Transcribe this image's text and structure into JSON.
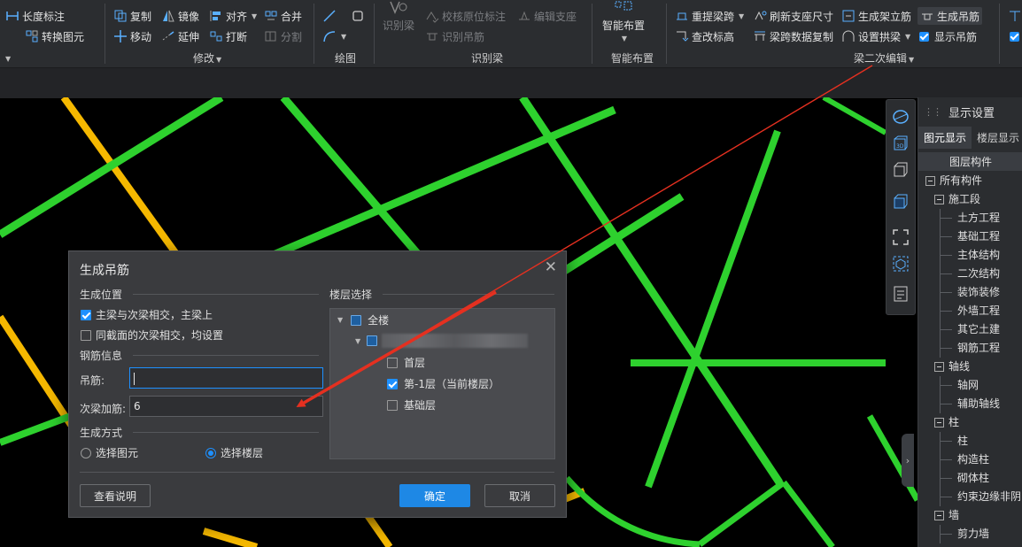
{
  "ribbon": {
    "tools": {
      "length_dim": "长度标注",
      "convert": "转换图元",
      "copy": "复制",
      "mirror": "镜像",
      "align": "对齐",
      "merge": "合并",
      "move": "移动",
      "extend": "延伸",
      "break": "打断",
      "split": "分割",
      "identify_beam": "识别梁",
      "verify_span": "校核原位标注",
      "edit_support": "编辑支座",
      "identify_hanger": "识别吊筋",
      "smart_layout": "智能布置",
      "redo_span": "重提梁跨",
      "refresh_support": "刷新支座尺寸",
      "gen_stirrup": "生成架立筋",
      "gen_hanger": "生成吊筋",
      "check_elev": "查改标高",
      "span_copy": "梁跨数据复制",
      "set_arch": "设置拱梁",
      "show_hanger": "显示吊筋"
    },
    "groups": {
      "modify": "修改",
      "draw": "绘图",
      "identify": "识别梁",
      "smart": "智能布置",
      "secondary_edit": "梁二次编辑"
    }
  },
  "panel": {
    "title": "显示设置",
    "tabs": [
      "图元显示",
      "楼层显示"
    ],
    "column_header": "图层构件",
    "tree": [
      {
        "label": "所有构件",
        "level": 0,
        "box": true
      },
      {
        "label": "施工段",
        "level": 1,
        "box": true
      },
      {
        "label": "土方工程",
        "level": 2,
        "box": false
      },
      {
        "label": "基础工程",
        "level": 2,
        "box": false
      },
      {
        "label": "主体结构",
        "level": 2,
        "box": false
      },
      {
        "label": "二次结构",
        "level": 2,
        "box": false
      },
      {
        "label": "装饰装修",
        "level": 2,
        "box": false
      },
      {
        "label": "外墙工程",
        "level": 2,
        "box": false
      },
      {
        "label": "其它土建",
        "level": 2,
        "box": false
      },
      {
        "label": "钢筋工程",
        "level": 2,
        "box": false
      },
      {
        "label": "轴线",
        "level": 1,
        "box": true
      },
      {
        "label": "轴网",
        "level": 2,
        "box": false
      },
      {
        "label": "辅助轴线",
        "level": 2,
        "box": false
      },
      {
        "label": "柱",
        "level": 1,
        "box": true
      },
      {
        "label": "柱",
        "level": 2,
        "box": false
      },
      {
        "label": "构造柱",
        "level": 2,
        "box": false
      },
      {
        "label": "砌体柱",
        "level": 2,
        "box": false
      },
      {
        "label": "约束边缘非阴",
        "level": 2,
        "box": false
      },
      {
        "label": "墙",
        "level": 1,
        "box": true
      },
      {
        "label": "剪力墙",
        "level": 2,
        "box": false
      }
    ]
  },
  "dialog": {
    "title": "生成吊筋",
    "section_position": "生成位置",
    "opt_main_secondary": "主梁与次梁相交，主梁上",
    "opt_main_secondary_checked": true,
    "opt_same_section": "同截面的次梁相交，均设置",
    "opt_same_section_checked": false,
    "section_rebar": "钢筋信息",
    "label_hanger": "吊筋:",
    "value_hanger": "",
    "label_secondary": "次梁加筋:",
    "value_secondary": "6",
    "section_method": "生成方式",
    "opt_select_element": "选择图元",
    "opt_select_floor": "选择楼层",
    "selected_method": "选择楼层",
    "section_floor": "楼层选择",
    "floor_all": "全楼",
    "floors": [
      {
        "label": "首层",
        "checked": false
      },
      {
        "label": "第-1层（当前楼层）",
        "checked": true
      },
      {
        "label": "基础层",
        "checked": false
      }
    ],
    "btn_help": "查看说明",
    "btn_ok": "确定",
    "btn_cancel": "取消"
  },
  "colors": {
    "accent": "#1e90ff",
    "beam_green": "#2ed12e",
    "beam_yellow": "#f5b800",
    "arrow_red": "#e53020"
  }
}
